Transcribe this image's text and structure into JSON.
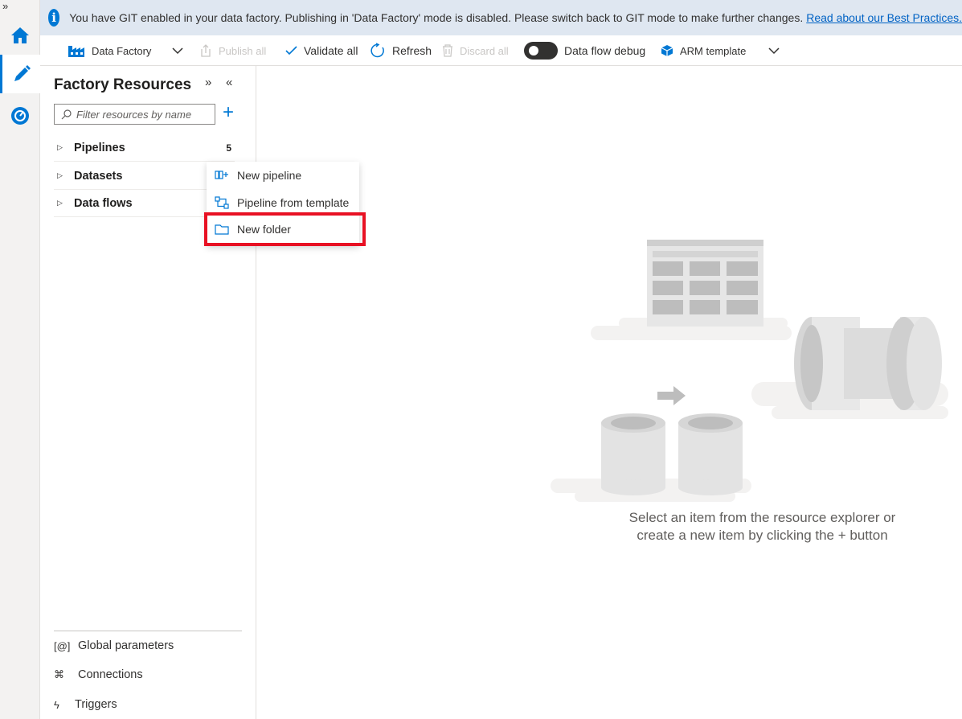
{
  "left_rail": {
    "expand_glyph": "»",
    "items": [
      {
        "name": "home-icon"
      },
      {
        "name": "author-pencil-icon"
      },
      {
        "name": "monitor-icon"
      }
    ]
  },
  "banner": {
    "icon": "info-icon",
    "message": "You have GIT enabled in your data factory. Publishing in 'Data Factory' mode is disabled. Please switch back to GIT mode to make further changes.",
    "link": "Read about our Best Practices."
  },
  "toolbar": {
    "factory_label": "Data Factory",
    "publish_label": "Publish all",
    "validate_label": "Validate all",
    "refresh_label": "Refresh",
    "discard_label": "Discard all",
    "dataflow_debug_label": "Data flow debug",
    "arm_label": "ARM template"
  },
  "panel": {
    "title": "Factory Resources",
    "filter_placeholder": "Filter resources by name",
    "tree": [
      {
        "label": "Pipelines",
        "count": "5"
      },
      {
        "label": "Datasets",
        "count": ""
      },
      {
        "label": "Data flows",
        "count": ""
      }
    ],
    "bottom": [
      {
        "label": "Global parameters",
        "glyph": "[@]"
      },
      {
        "label": "Connections",
        "glyph": "⌘"
      },
      {
        "label": "Triggers",
        "glyph": "ϟ"
      }
    ]
  },
  "context_menu": {
    "items": [
      {
        "label": "New pipeline",
        "icon": "pipeline-icon"
      },
      {
        "label": "Pipeline from template",
        "icon": "template-icon"
      },
      {
        "label": "New folder",
        "icon": "folder-icon"
      }
    ]
  },
  "empty_state": {
    "line1": "Select an item from the resource explorer or",
    "line2": "create a new item by clicking the + button"
  },
  "colors": {
    "accent": "#0078d4",
    "highlight": "#e81123",
    "banner_bg": "#dfe7f1"
  }
}
